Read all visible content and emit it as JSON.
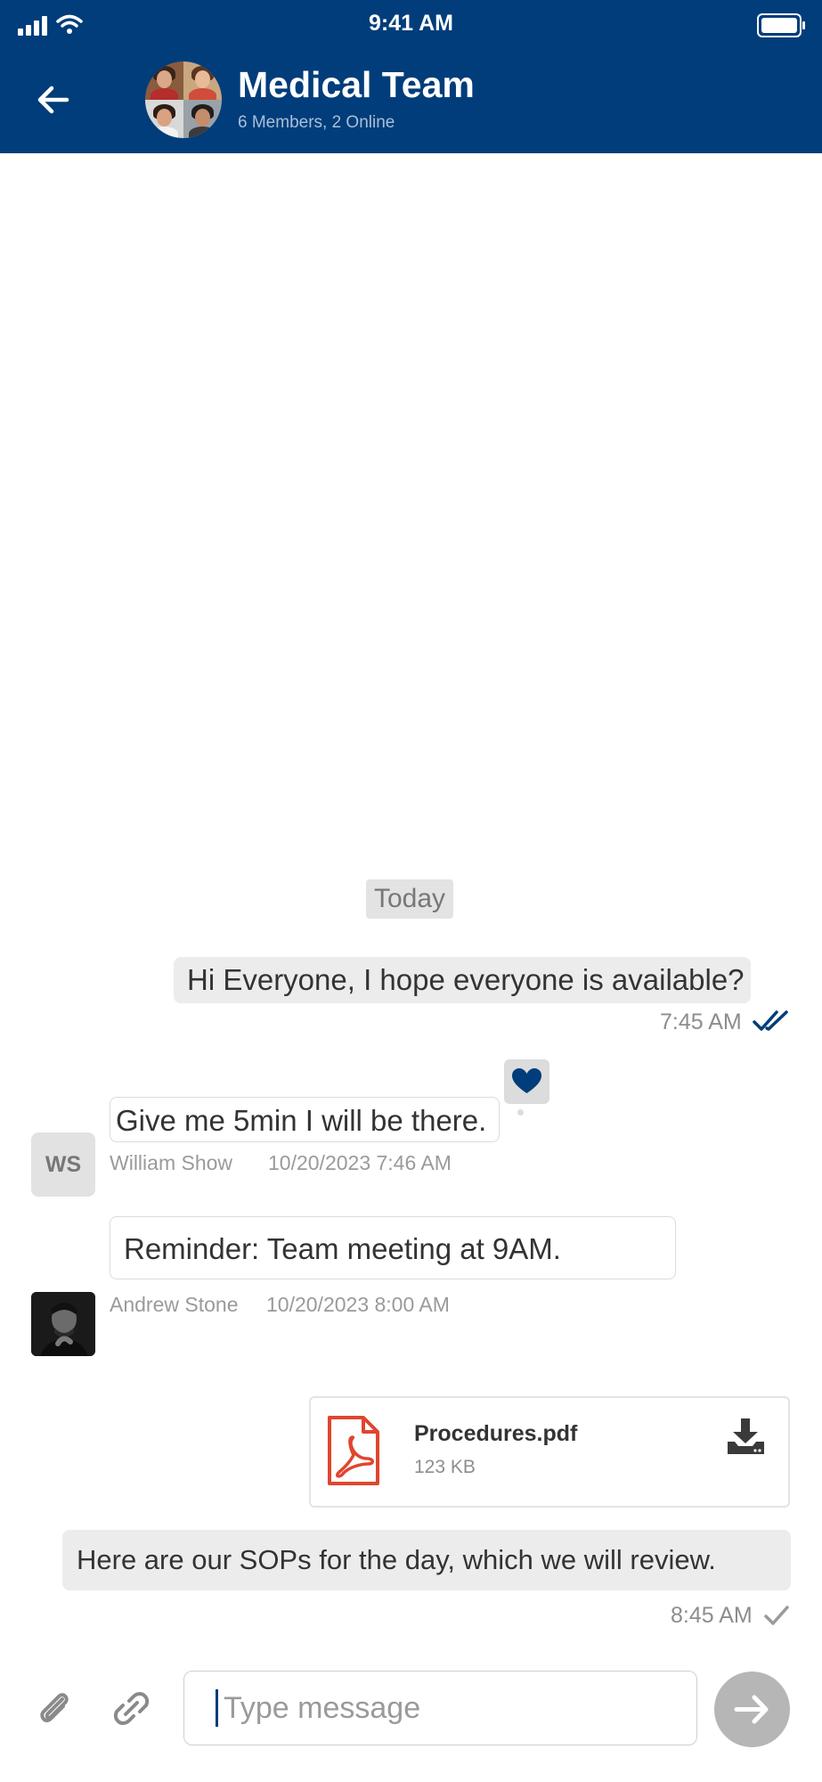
{
  "status_bar": {
    "time": "9:41 AM"
  },
  "header": {
    "title": "Medical Team",
    "subtitle": "6 Members, 2 Online"
  },
  "divider": {
    "label": "Today"
  },
  "messages": [
    {
      "text": "Hi Everyone, I hope everyone is available?",
      "time": "7:45 AM",
      "status": "read"
    },
    {
      "text": "Give me 5min I will be there.",
      "sender": "William Show",
      "timestamp": "10/20/2023 7:46 AM",
      "avatar_initials": "WS",
      "reaction": "heart-icon"
    },
    {
      "text": "Reminder: Team meeting at 9AM.",
      "sender": "Andrew Stone",
      "timestamp": "10/20/2023 8:00 AM"
    },
    {
      "attachment": {
        "name": "Procedures.pdf",
        "size": "123 KB"
      },
      "text": "Here are our SOPs for the day, which we will review.",
      "time": "8:45 AM",
      "status": "sent"
    }
  ],
  "composer": {
    "placeholder": "Type message"
  },
  "colors": {
    "primary": "#003d7a",
    "bubble_out": "#ececec",
    "pdf_red": "#e0452f",
    "send_disabled": "#b6b6b6"
  }
}
